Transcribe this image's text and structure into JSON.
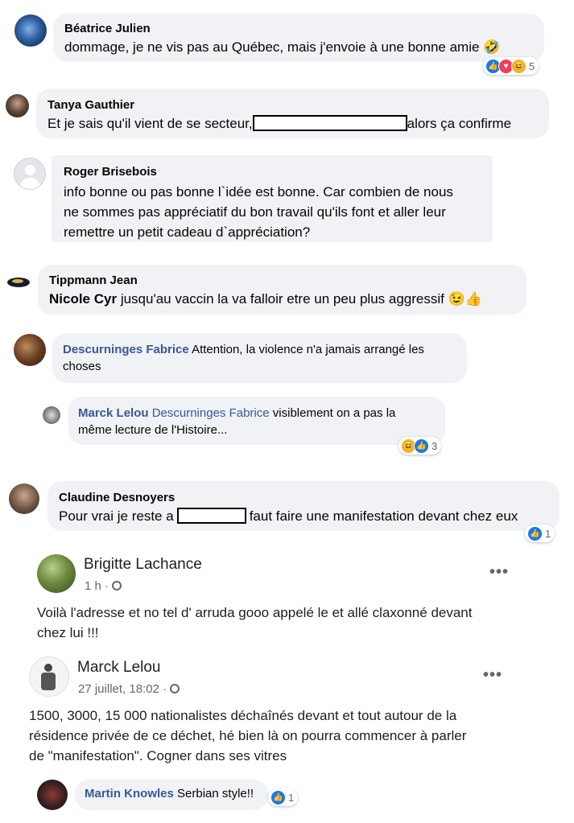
{
  "comments": [
    {
      "name": "Béatrice Julien",
      "text": "dommage, je ne vis pas au Québec, mais j'envoie à une bonne amie 🤣",
      "reaction_count": "5"
    },
    {
      "name": "Tanya Gauthier",
      "text_before": "Et je sais qu'il vient de se secteur,",
      "text_after": "alors ça confirme"
    },
    {
      "name": "Roger Brisebois",
      "lines": [
        "info bonne ou pas bonne l`idée est bonne. Car combien de nous",
        "ne sommes pas appréciatif du bon travail qu'ils font et aller leur",
        "remettre  un petit cadeau d`appréciation?"
      ]
    },
    {
      "name": "Tippmann Jean",
      "mention": "Nicole Cyr",
      "text": " jusqu'au vaccin la va falloir etre un peu plus aggressif 😉👍"
    },
    {
      "name": "Descurninges Fabrice",
      "text": " Attention, la violence n'a jamais arrangé les",
      "text2": "choses"
    },
    {
      "name": "Marck Lelou",
      "mention": "Descurninges Fabrice",
      "text": " visiblement on a pas la",
      "text2": "même lecture de l'Histoire...",
      "reaction_count": "3"
    },
    {
      "name": "Claudine Desnoyers",
      "text_before": "Pour vrai je reste a",
      "text_after": "faut faire une manifestation devant chez eux",
      "reaction_count": "1"
    }
  ],
  "posts": [
    {
      "name": "Brigitte Lachance",
      "time": "1 h ·",
      "lines": [
        "Voilà l'adresse et no tel d' arruda gooo appelé le et allé claxonné devant",
        "chez lui !!!"
      ],
      "menu": "•••"
    },
    {
      "name": "Marck Lelou",
      "time": "27 juillet, 18:02 ·",
      "lines": [
        "1500, 3000, 15 000 nationalistes déchaînés devant et tout autour de la",
        "résidence privée de ce déchet, hé bien là on pourra commencer à parler",
        "de \"manifestation\". Cogner dans ses vitres"
      ],
      "menu": "•••"
    }
  ],
  "last_comment": {
    "name": "Martin Knowles",
    "text": " Serbian style!!",
    "reaction_count": "1"
  },
  "colors": {
    "bubble": "#f0f2f5",
    "link": "#385898",
    "like": "#1877f2",
    "love": "#f33e58",
    "haha": "#f7b125"
  }
}
